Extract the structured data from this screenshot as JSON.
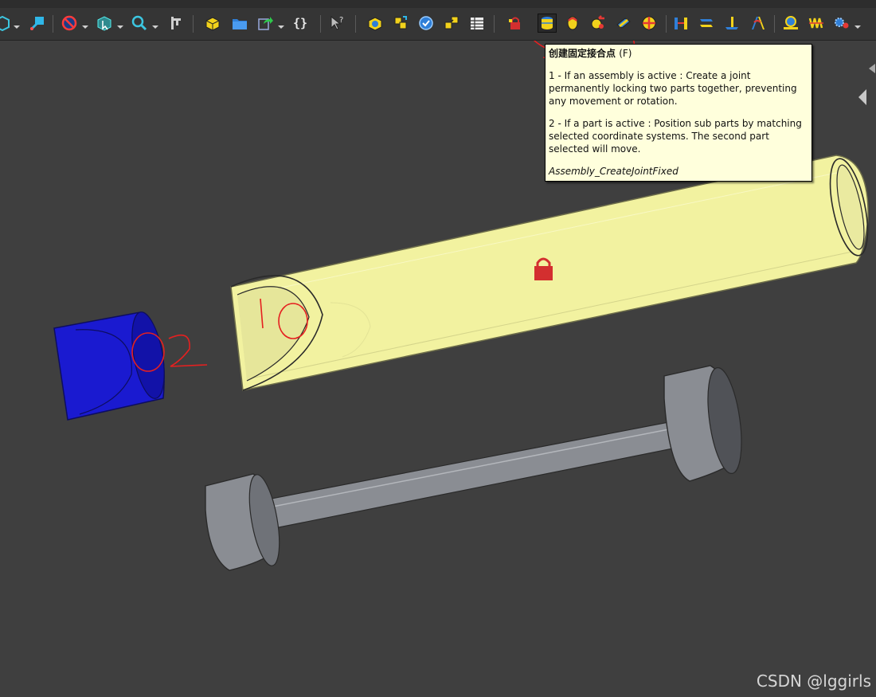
{
  "tooltip": {
    "title": "创建固定接合点",
    "shortcut": "(F)",
    "line1": "1 - If an assembly is active : Create a joint permanently locking two parts together, preventing any movement or rotation.",
    "line2": "2 - If a part is active : Position sub parts by matching selected coordinate systems. The second part selected will move.",
    "command": "Assembly_CreateJointFixed"
  },
  "braces_label": "{}",
  "annotations": {
    "label_part1": "1O",
    "label_part2": "O2"
  },
  "watermark": "CSDN @lggirls",
  "colors": {
    "toolbar": "#353535",
    "viewport": "#3f3f3f",
    "pipe": "#f2f2a0",
    "cap": "#1a1ad0",
    "shaft": "#8a8d93",
    "lock": "#d32f2f",
    "annotation": "#e52020"
  }
}
